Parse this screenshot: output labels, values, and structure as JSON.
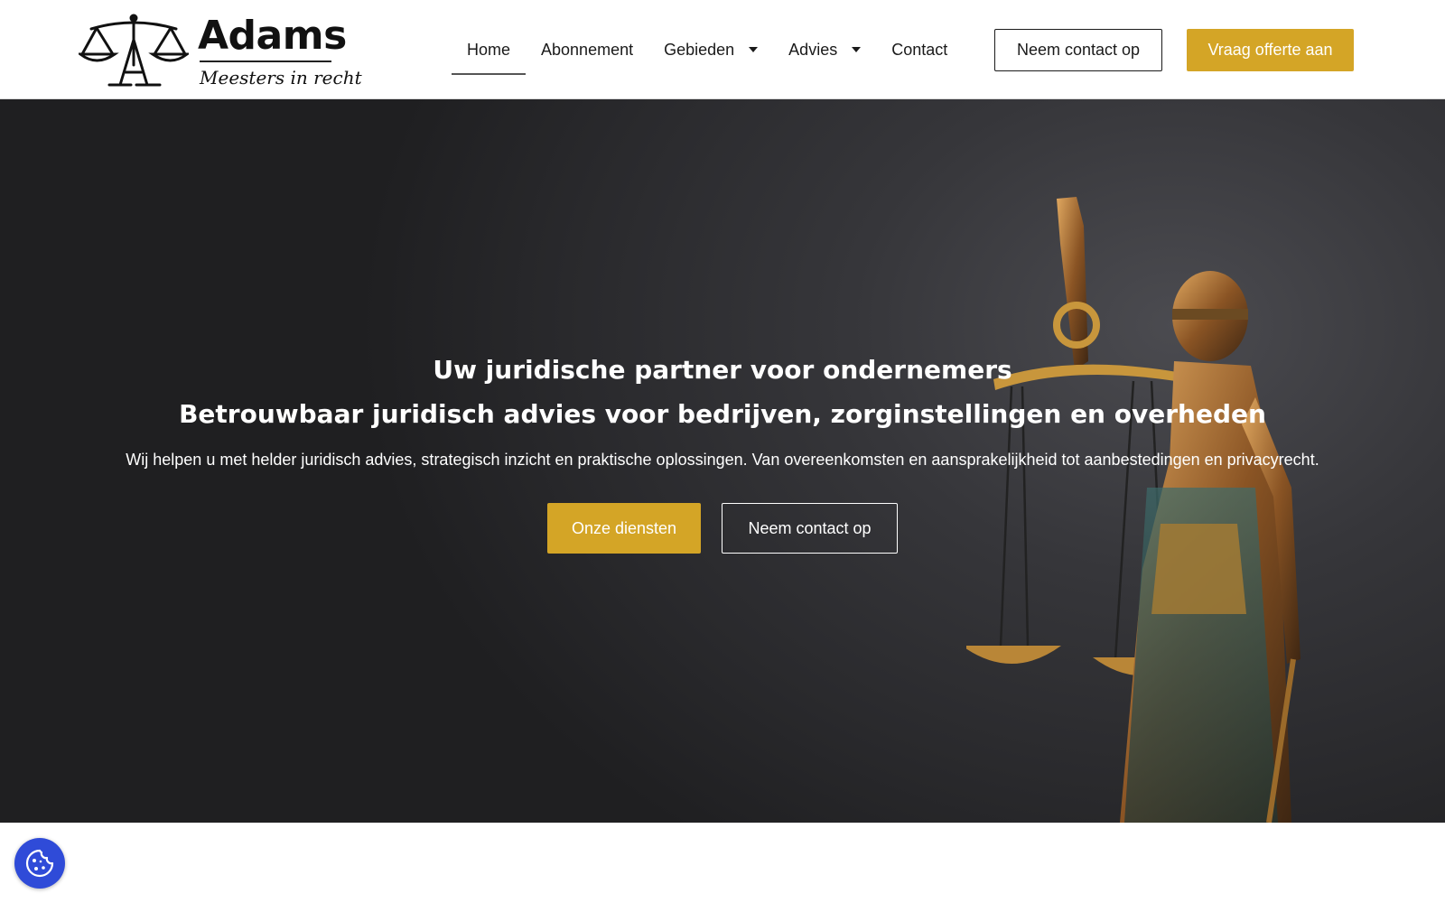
{
  "logo": {
    "name": "Adams",
    "tagline": "Meesters in recht"
  },
  "nav": [
    {
      "label": "Home"
    },
    {
      "label": "Abonnement"
    },
    {
      "label": "Gebieden"
    },
    {
      "label": "Advies"
    },
    {
      "label": "Contact"
    }
  ],
  "header_buttons": {
    "contact": "Neem contact op",
    "quote": "Vraag offerte aan"
  },
  "hero": {
    "title": "Uw juridische partner voor ondernemers",
    "subtitle": "Betrouwbaar juridisch advies voor bedrijven, zorginstellingen en overheden",
    "description": "Wij helpen u met helder juridisch advies, strategisch inzicht en praktische oplossingen. Van overeenkomsten en aansprakelijkheid tot aanbestedingen en privacyrecht.",
    "primary_button": "Onze diensten",
    "secondary_button": "Neem contact op"
  },
  "colors": {
    "accent": "#d4a526",
    "cookie": "#2f4bd8",
    "hero_bg": "#2b2b2e"
  },
  "icons": {
    "logo": "scales-of-justice-icon",
    "cookie": "cookie-icon",
    "dropdown": "caret-down-icon"
  }
}
